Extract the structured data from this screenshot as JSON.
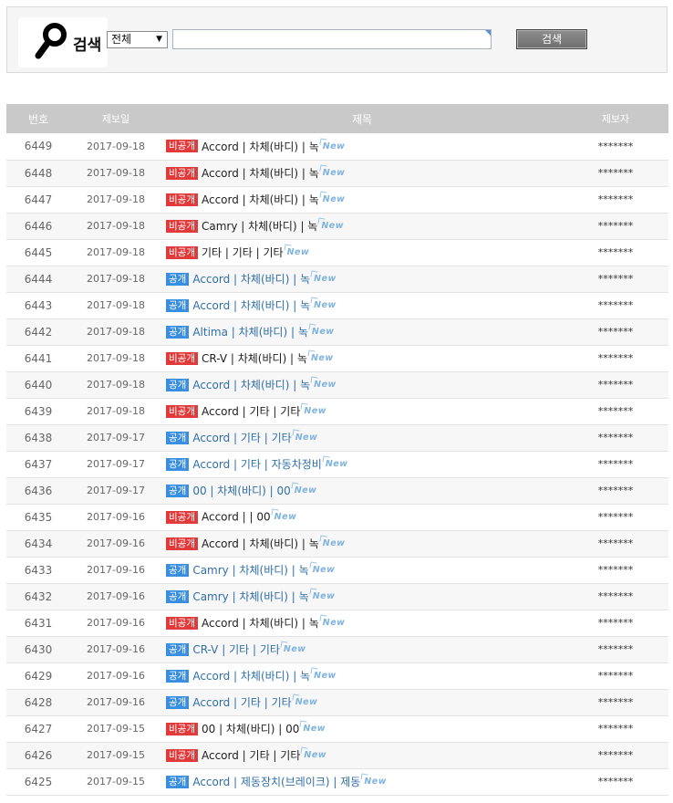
{
  "search": {
    "title": "검색",
    "select_value": "전체",
    "input_value": "",
    "button_label": "검색"
  },
  "table": {
    "headers": {
      "num": "번호",
      "date": "제보일",
      "title": "제목",
      "author": "제보자"
    },
    "rows": [
      {
        "num": "6449",
        "date": "2017-09-18",
        "status": "비공개",
        "title": "Accord | 차체(바디) | 녹",
        "author": "*******"
      },
      {
        "num": "6448",
        "date": "2017-09-18",
        "status": "비공개",
        "title": "Accord | 차체(바디) | 녹",
        "author": "*******"
      },
      {
        "num": "6447",
        "date": "2017-09-18",
        "status": "비공개",
        "title": "Accord | 차체(바디) | 녹",
        "author": "*******"
      },
      {
        "num": "6446",
        "date": "2017-09-18",
        "status": "비공개",
        "title": "Camry | 차체(바디) | 녹",
        "author": "*******"
      },
      {
        "num": "6445",
        "date": "2017-09-18",
        "status": "비공개",
        "title": "기타 | 기타 | 기타",
        "author": "*******"
      },
      {
        "num": "6444",
        "date": "2017-09-18",
        "status": "공개",
        "title": "Accord | 차체(바디) | 녹",
        "author": "*******"
      },
      {
        "num": "6443",
        "date": "2017-09-18",
        "status": "공개",
        "title": "Accord | 차체(바디) | 녹",
        "author": "*******"
      },
      {
        "num": "6442",
        "date": "2017-09-18",
        "status": "공개",
        "title": "Altima | 차체(바디) | 녹",
        "author": "*******"
      },
      {
        "num": "6441",
        "date": "2017-09-18",
        "status": "비공개",
        "title": "CR-V | 차체(바디) | 녹",
        "author": "*******"
      },
      {
        "num": "6440",
        "date": "2017-09-18",
        "status": "공개",
        "title": "Accord | 차체(바디) | 녹",
        "author": "*******"
      },
      {
        "num": "6439",
        "date": "2017-09-18",
        "status": "비공개",
        "title": "Accord | 기타 | 기타",
        "author": "*******"
      },
      {
        "num": "6438",
        "date": "2017-09-17",
        "status": "공개",
        "title": "Accord | 기타 | 기타",
        "author": "*******"
      },
      {
        "num": "6437",
        "date": "2017-09-17",
        "status": "공개",
        "title": "Accord | 기타 | 자동차정비",
        "author": "*******"
      },
      {
        "num": "6436",
        "date": "2017-09-17",
        "status": "공개",
        "title": "00 | 차체(바디) | 00",
        "author": "*******"
      },
      {
        "num": "6435",
        "date": "2017-09-16",
        "status": "비공개",
        "title": "Accord | | 00",
        "author": "*******"
      },
      {
        "num": "6434",
        "date": "2017-09-16",
        "status": "비공개",
        "title": "Accord | 차체(바디) | 녹",
        "author": "*******"
      },
      {
        "num": "6433",
        "date": "2017-09-16",
        "status": "공개",
        "title": "Camry | 차체(바디) | 녹",
        "author": "*******"
      },
      {
        "num": "6432",
        "date": "2017-09-16",
        "status": "공개",
        "title": "Camry | 차체(바디) | 녹",
        "author": "*******"
      },
      {
        "num": "6431",
        "date": "2017-09-16",
        "status": "비공개",
        "title": "Accord | 차체(바디) | 녹",
        "author": "*******"
      },
      {
        "num": "6430",
        "date": "2017-09-16",
        "status": "공개",
        "title": "CR-V | 기타 | 기타",
        "author": "*******"
      },
      {
        "num": "6429",
        "date": "2017-09-16",
        "status": "공개",
        "title": "Accord | 차체(바디) | 녹",
        "author": "*******"
      },
      {
        "num": "6428",
        "date": "2017-09-16",
        "status": "공개",
        "title": "Accord | 기타 | 기타",
        "author": "*******"
      },
      {
        "num": "6427",
        "date": "2017-09-15",
        "status": "비공개",
        "title": "00 | 차체(바디) | 00",
        "author": "*******"
      },
      {
        "num": "6426",
        "date": "2017-09-15",
        "status": "비공개",
        "title": "Accord | 기타 | 기타",
        "author": "*******"
      },
      {
        "num": "6425",
        "date": "2017-09-15",
        "status": "공개",
        "title": "Accord | 제동장치(브레이크) | 제동",
        "author": "*******"
      }
    ],
    "new_label": "New"
  },
  "colors": {
    "private_badge": "#e03a3a",
    "public_badge": "#3a8ee0",
    "header_bg": "#c9c9c9"
  }
}
